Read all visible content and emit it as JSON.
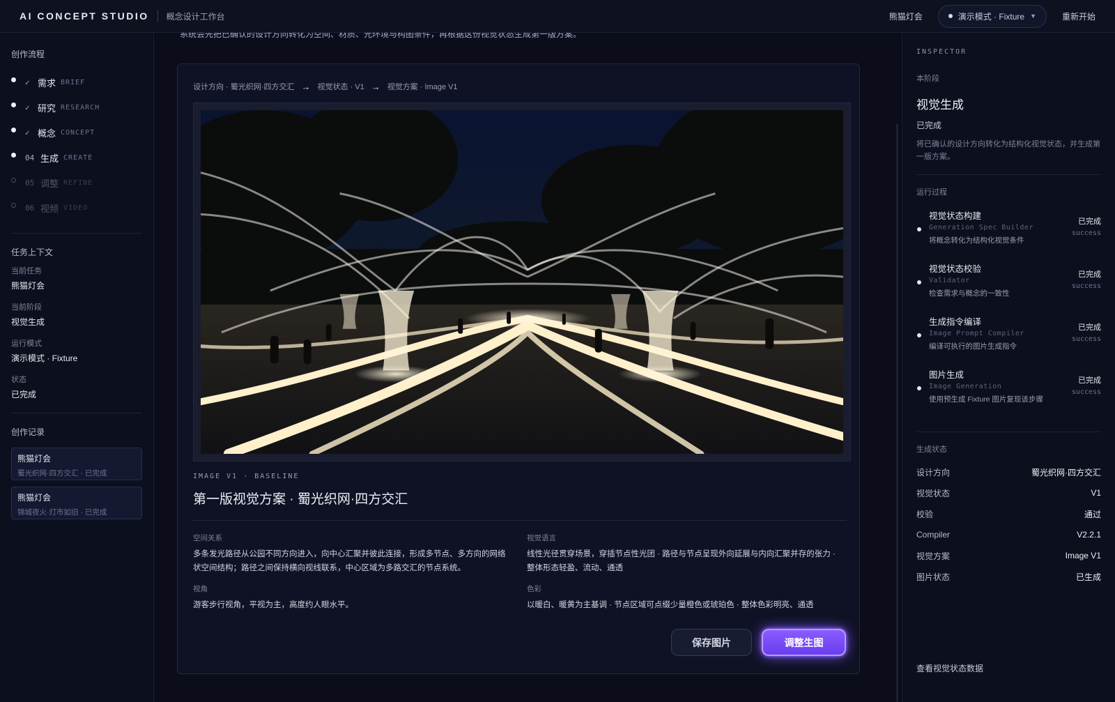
{
  "topbar": {
    "brand": "AI CONCEPT STUDIO",
    "subtitle": "概念设计工作台",
    "project": "熊猫灯会",
    "mode": "演示模式 · Fixture",
    "restart": "重新开始"
  },
  "sidebar": {
    "flow_title": "创作流程",
    "steps": [
      {
        "mark": "✓",
        "zh": "需求",
        "en": "BRIEF"
      },
      {
        "mark": "✓",
        "zh": "研究",
        "en": "RESEARCH"
      },
      {
        "mark": "✓",
        "zh": "概念",
        "en": "CONCEPT"
      },
      {
        "mark": "04",
        "zh": "生成",
        "en": "CREATE"
      },
      {
        "mark": "05",
        "zh": "调整",
        "en": "REFINE"
      },
      {
        "mark": "06",
        "zh": "视频",
        "en": "VIDEO"
      }
    ],
    "context_title": "任务上下文",
    "context": [
      {
        "label": "当前任务",
        "value": "熊猫灯会"
      },
      {
        "label": "当前阶段",
        "value": "视觉生成"
      },
      {
        "label": "运行模式",
        "value": "演示模式 · Fixture"
      },
      {
        "label": "状态",
        "value": "已完成"
      }
    ],
    "history_title": "创作记录",
    "history": [
      {
        "title": "熊猫灯会",
        "sub": "蜀光织网·四方交汇 · 已完成"
      },
      {
        "title": "熊猫灯会",
        "sub": "锦城夜火·灯市如旧 · 已完成"
      }
    ]
  },
  "main": {
    "cut_text": "系统会先把已确认的设计方向转化为空间、材质、光环境与构图条件，再根据这份视觉状态生成第一版方案。",
    "crumbs": [
      "设计方向 · 蜀光织网·四方交汇",
      "视觉状态 · V1",
      "视觉方案 · Image V1"
    ],
    "crumb_arrow": "→",
    "image_tag": "IMAGE V1 · BASELINE",
    "image_title": "第一版视觉方案 · 蜀光织网·四方交汇",
    "fields": [
      {
        "label": "空间关系",
        "text": "多条发光路径从公园不同方向进入，向中心汇聚并彼此连接，形成多节点、多方向的网络状空间结构；路径之间保持横向视线联系，中心区域为多路交汇的节点系统。"
      },
      {
        "label": "视觉语言",
        "text": "线性光径贯穿场景，穿插节点性光团 · 路径与节点呈现外向延展与内向汇聚并存的张力 · 整体形态轻盈、流动、通透"
      },
      {
        "label": "视角",
        "text": "游客步行视角，平视为主，高度约人眼水平。"
      },
      {
        "label": "色彩",
        "text": "以暖白、暖黄为主基调 · 节点区域可点缀少量橙色或琥珀色 · 整体色彩明亮、通透"
      }
    ],
    "save_label": "保存图片",
    "adjust_label": "调整生图"
  },
  "inspector": {
    "head": "INSPECTOR",
    "stage_label": "本阶段",
    "stage_title": "视觉生成",
    "stage_status": "已完成",
    "stage_desc": "将已确认的设计方向转化为结构化视觉状态，并生成第一版方案。",
    "run_title": "运行过程",
    "runs": [
      {
        "name": "视觉状态构建",
        "code": "Generation Spec Builder",
        "desc": "将概念转化为结构化视觉条件",
        "status": "已完成",
        "status_en": "success"
      },
      {
        "name": "视觉状态校验",
        "code": "Validator",
        "desc": "检查需求与概念的一致性",
        "status": "已完成",
        "status_en": "success"
      },
      {
        "name": "生成指令编译",
        "code": "Image Prompt Compiler",
        "desc": "编译可执行的图片生成指令",
        "status": "已完成",
        "status_en": "success"
      },
      {
        "name": "图片生成",
        "code": "Image Generation",
        "desc": "使用预生成 Fixture 图片复现该步骤",
        "status": "已完成",
        "status_en": "success"
      }
    ],
    "gen_title": "生成状态",
    "gen": [
      {
        "k": "设计方向",
        "v": "蜀光织网·四方交汇"
      },
      {
        "k": "视觉状态",
        "v": "V1"
      },
      {
        "k": "校验",
        "v": "通过"
      },
      {
        "k": "Compiler",
        "v": "V2.2.1"
      },
      {
        "k": "视觉方案",
        "v": "Image V1"
      },
      {
        "k": "图片状态",
        "v": "已生成"
      }
    ],
    "view_link": "查看视觉状态数据"
  },
  "colors": {
    "background": "#0b0d1a",
    "panel": "#0c0f1e",
    "accent": "#7b4dff",
    "light": "#fff3d6"
  }
}
